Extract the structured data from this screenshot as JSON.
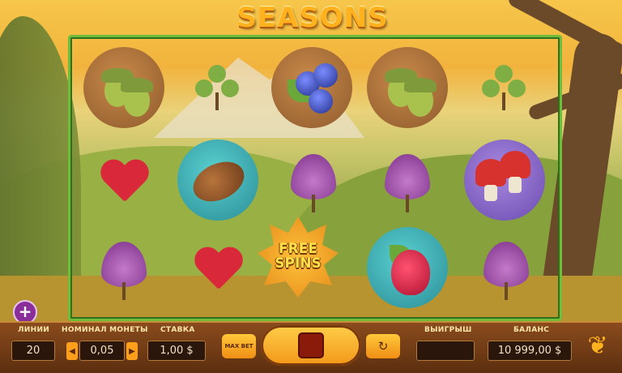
{
  "game": {
    "title": "SEASONS"
  },
  "reels": {
    "symbols": [
      [
        "acorns",
        "clover-leaf",
        "blueberries",
        "acorns",
        "clover-leaf"
      ],
      [
        "red-heart-leaf",
        "pine-cone",
        "purple-leaf",
        "purple-leaf",
        "mushrooms"
      ],
      [
        "purple-leaf",
        "red-heart-leaf",
        "free-spins-scatter",
        "strawberry",
        "purple-leaf"
      ]
    ],
    "scatter_text": "FREE SPINS"
  },
  "panel": {
    "lines_label": "ЛИНИИ",
    "lines_value": "20",
    "coin_label": "НОМИНАЛ МОНЕТЫ",
    "coin_value": "0,05",
    "bet_label": "СТАВКА",
    "bet_value": "1,00 $",
    "win_label": "ВЫИГРЫШ",
    "win_value": "",
    "balance_label": "БАЛАНС",
    "balance_value": "10 999,00 $",
    "maxbet_label": "MAX BET",
    "coin_left_icon": "arrow-left-icon",
    "coin_right_icon": "arrow-right-icon",
    "autoplay_icon": "autoplay-icon",
    "spin_icon": "stop-icon",
    "more_icon": "plus-icon",
    "brand_icon": "yggdrasil-tree-icon"
  },
  "colors": {
    "accent": "#ffb21e",
    "frame": "#6fbd3b",
    "panel": "#6e3a14"
  }
}
